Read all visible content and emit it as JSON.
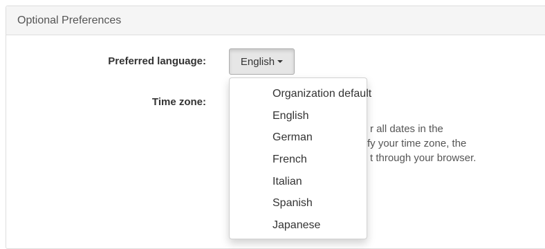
{
  "panel": {
    "heading": "Optional Preferences"
  },
  "form": {
    "language_label": "Preferred language:",
    "language_value": "English",
    "timezone_label": "Time zone:",
    "timezone_help": [
      "r all dates in the",
      "fy your time zone, the",
      "t through your browser."
    ]
  },
  "language_dropdown": {
    "options": [
      "Organization default",
      "English",
      "German",
      "French",
      "Italian",
      "Spanish",
      "Japanese"
    ]
  },
  "icons": {
    "caret": "caret-down-icon"
  }
}
